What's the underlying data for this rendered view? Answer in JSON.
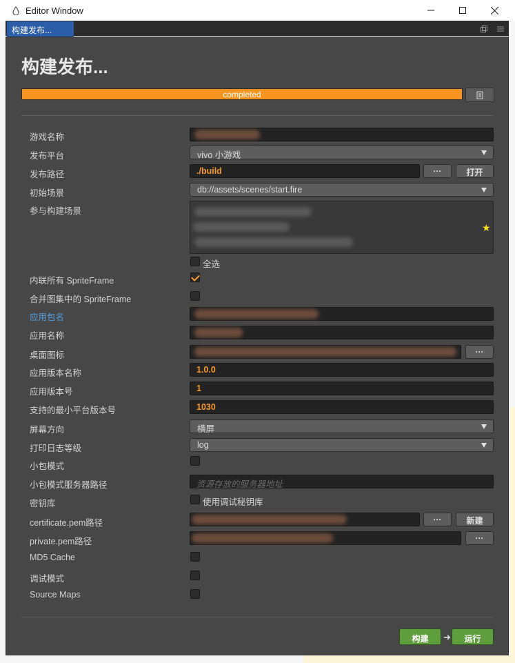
{
  "window": {
    "title": "Editor Window",
    "tab_label": "构建发布..."
  },
  "heading": "构建发布...",
  "progress": {
    "text": "completed",
    "percent": 100
  },
  "fields": {
    "game_name_label": "游戏名称",
    "platform_label": "发布平台",
    "platform_value": "vivo 小游戏",
    "path_label": "发布路径",
    "path_value": "./build",
    "path_browse": "···",
    "path_open": "打开",
    "start_scene_label": "初始场景",
    "start_scene_value": "db://assets/scenes/start.fire",
    "build_scenes_label": "参与构建场景",
    "select_all_label": "全选",
    "inline_sprite_label": "内联所有 SpriteFrame",
    "merge_sprite_label": "合并图集中的 SpriteFrame",
    "package_name_label": "应用包名",
    "app_name_label": "应用名称",
    "desktop_icon_label": "桌面图标",
    "desktop_icon_browse": "···",
    "version_name_label": "应用版本名称",
    "version_name_value": "1.0.0",
    "version_code_label": "应用版本号",
    "version_code_value": "1",
    "min_platform_label": "支持的最小平台版本号",
    "min_platform_value": "1030",
    "orientation_label": "屏幕方向",
    "orientation_value": "横屏",
    "log_level_label": "打印日志等级",
    "log_level_value": "log",
    "subpackage_label": "小包模式",
    "subpackage_server_label": "小包模式服务器路径",
    "subpackage_server_placeholder": "资源存放的服务器地址",
    "keystore_label": "密钥库",
    "keystore_debug_label": "使用调试秘钥库",
    "cert_label": "certificate.pem路径",
    "cert_browse": "···",
    "cert_new": "新建",
    "private_label": "private.pem路径",
    "private_browse": "···",
    "md5_label": "MD5 Cache",
    "debug_label": "调试模式",
    "sourcemaps_label": "Source Maps"
  },
  "actions": {
    "build": "构建",
    "run": "运行"
  },
  "colors": {
    "accent": "#f79a2b",
    "panel": "#474747",
    "build_green": "#5f9e3c",
    "tab_blue": "#2c5da8"
  }
}
